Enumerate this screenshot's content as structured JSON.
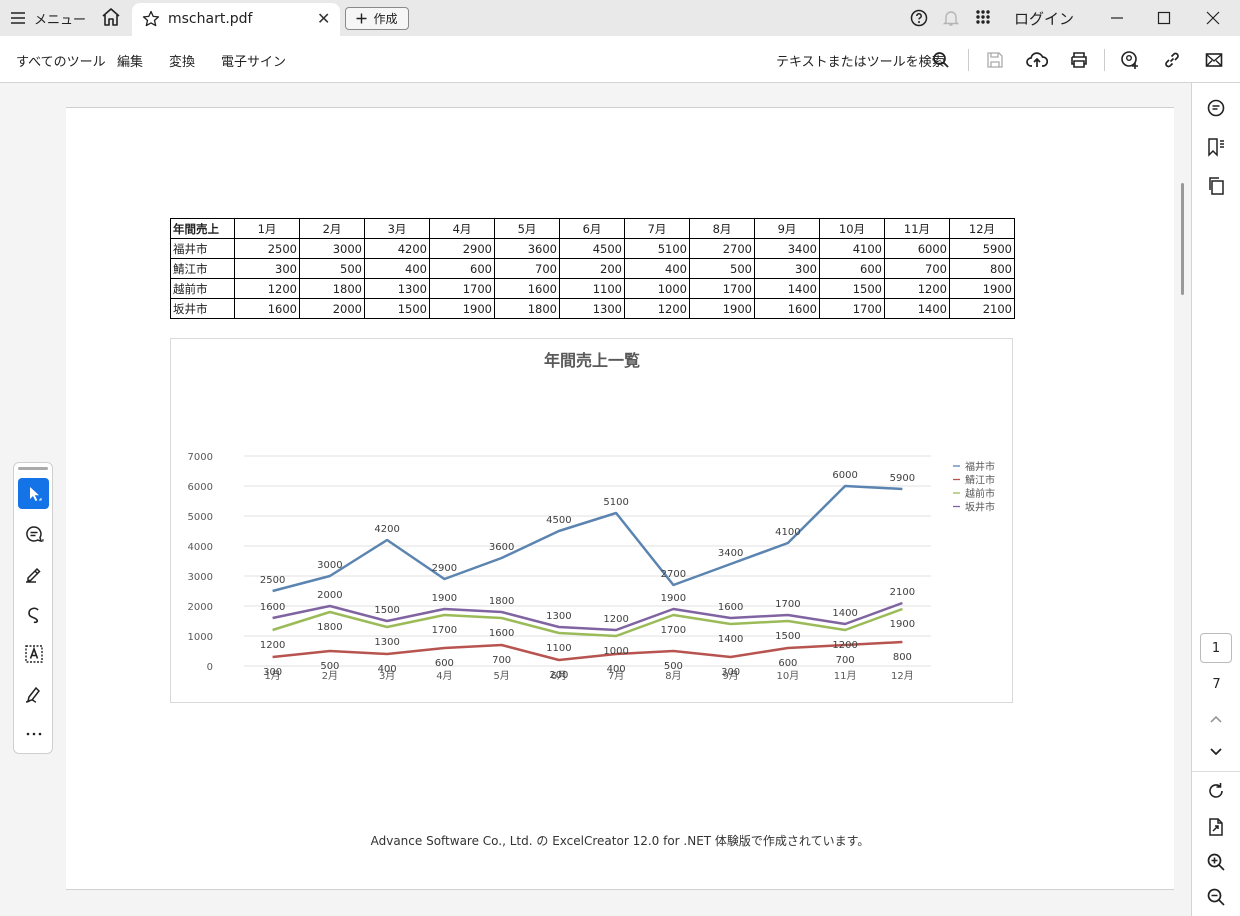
{
  "titlebar": {
    "menu_label": "メニュー",
    "tab_title": "mschart.pdf",
    "tab_close": "✕",
    "create_label": "作成",
    "login_label": "ログイン"
  },
  "toolbar": {
    "all_tools": "すべてのツール",
    "edit": "編集",
    "convert": "変換",
    "esign": "電子サイン",
    "search_label": "テキストまたはツールを検索"
  },
  "table": {
    "corner": "年間売上",
    "months": [
      "1月",
      "2月",
      "3月",
      "4月",
      "5月",
      "6月",
      "7月",
      "8月",
      "9月",
      "10月",
      "11月",
      "12月"
    ],
    "rows": [
      {
        "city": "福井市",
        "values": [
          "2500",
          "3000",
          "4200",
          "2900",
          "3600",
          "4500",
          "5100",
          "2700",
          "3400",
          "4100",
          "6000",
          "5900"
        ]
      },
      {
        "city": "鯖江市",
        "values": [
          "300",
          "500",
          "400",
          "600",
          "700",
          "200",
          "400",
          "500",
          "300",
          "600",
          "700",
          "800"
        ]
      },
      {
        "city": "越前市",
        "values": [
          "1200",
          "1800",
          "1300",
          "1700",
          "1600",
          "1100",
          "1000",
          "1700",
          "1400",
          "1500",
          "1200",
          "1900"
        ]
      },
      {
        "city": "坂井市",
        "values": [
          "1600",
          "2000",
          "1500",
          "1900",
          "1800",
          "1300",
          "1200",
          "1900",
          "1600",
          "1700",
          "1400",
          "2100"
        ]
      }
    ]
  },
  "chart_data": {
    "type": "line",
    "title": "年間売上一覧",
    "categories": [
      "1月",
      "2月",
      "3月",
      "4月",
      "5月",
      "6月",
      "7月",
      "8月",
      "9月",
      "10月",
      "11月",
      "12月"
    ],
    "ylim": [
      0,
      7000
    ],
    "yticks": [
      0,
      1000,
      2000,
      3000,
      4000,
      5000,
      6000,
      7000
    ],
    "grid": true,
    "legend": "right",
    "series": [
      {
        "name": "福井市",
        "color": "#5b84b1",
        "values": [
          2500,
          3000,
          4200,
          2900,
          3600,
          4500,
          5100,
          2700,
          3400,
          4100,
          6000,
          5900
        ]
      },
      {
        "name": "鯖江市",
        "color": "#b85450",
        "values": [
          300,
          500,
          400,
          600,
          700,
          200,
          400,
          500,
          300,
          600,
          700,
          800
        ]
      },
      {
        "name": "越前市",
        "color": "#9bbb59",
        "values": [
          1200,
          1800,
          1300,
          1700,
          1600,
          1100,
          1000,
          1700,
          1400,
          1500,
          1200,
          1900
        ]
      },
      {
        "name": "坂井市",
        "color": "#8064a2",
        "values": [
          1600,
          2000,
          1500,
          1900,
          1800,
          1300,
          1200,
          1900,
          1600,
          1700,
          1400,
          2100
        ]
      }
    ]
  },
  "footer": "Advance Software Co., Ltd. の ExcelCreator 12.0 for .NET 体験版で作成されています。",
  "pager": {
    "current": "1",
    "total": "7"
  }
}
